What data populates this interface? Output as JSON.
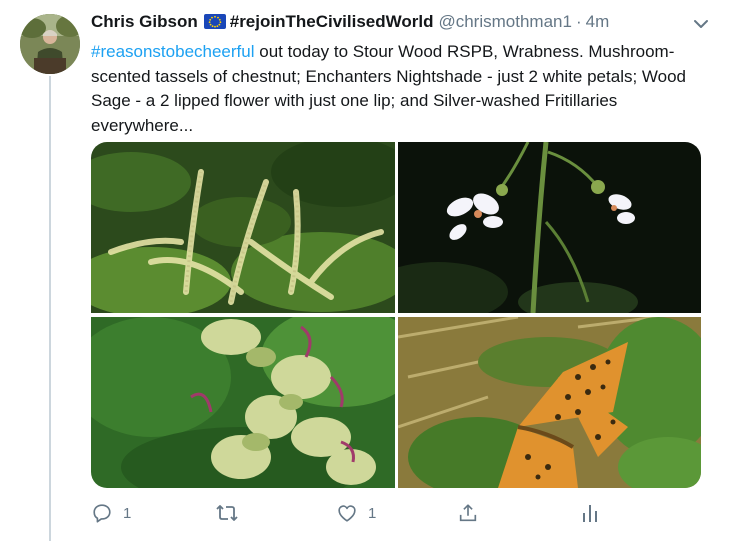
{
  "tweet": {
    "author_name": "Chris Gibson",
    "author_flag_icon": "eu-flag-icon",
    "author_name_tag": "#rejoinTheCivilisedWorld",
    "handle": "@chrismothman1",
    "separator": "·",
    "time": "4m",
    "hashtag": "#reasonstobecheerful",
    "body": " out today to Stour Wood RSPB, Wrabness. Mushroom-scented tassels of chestnut; Enchanters Nightshade - just 2 white petals; Wood Sage - a 2 lipped flower with just one lip; and Silver-washed Fritillaries everywhere..."
  },
  "actions": {
    "reply_count": "1",
    "retweet_count": "",
    "like_count": "1"
  },
  "colors": {
    "accent": "#1da1f2",
    "muted": "#657786",
    "thread_line": "#ccd6dd"
  }
}
